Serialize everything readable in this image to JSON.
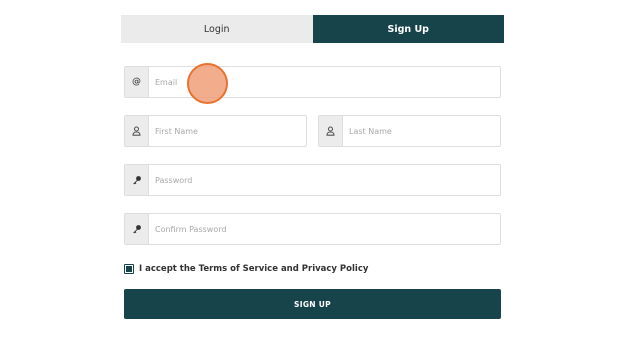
{
  "tabs": {
    "login_label": "Login",
    "signup_label": "Sign Up",
    "active": "Sign Up"
  },
  "form": {
    "email": {
      "placeholder": "Email",
      "value": "",
      "icon": "at-icon",
      "icon_glyph": "@"
    },
    "first_name": {
      "placeholder": "First Name",
      "value": "",
      "icon": "user-icon"
    },
    "last_name": {
      "placeholder": "Last Name",
      "value": "",
      "icon": "user-icon"
    },
    "password": {
      "placeholder": "Password",
      "value": "",
      "icon": "key-icon"
    },
    "confirm_password": {
      "placeholder": "Confirm Password",
      "value": "",
      "icon": "key-icon"
    },
    "terms": {
      "label": "I accept the Terms of Service and Privacy Policy",
      "checked": true
    },
    "submit_label": "SIGN UP"
  },
  "colors": {
    "primary": "#17434a",
    "tab_inactive": "#ebebeb",
    "addon_bg": "#ececec",
    "border": "#dedede",
    "cursor_fill": "#f0a078",
    "cursor_stroke": "#e8722e"
  }
}
